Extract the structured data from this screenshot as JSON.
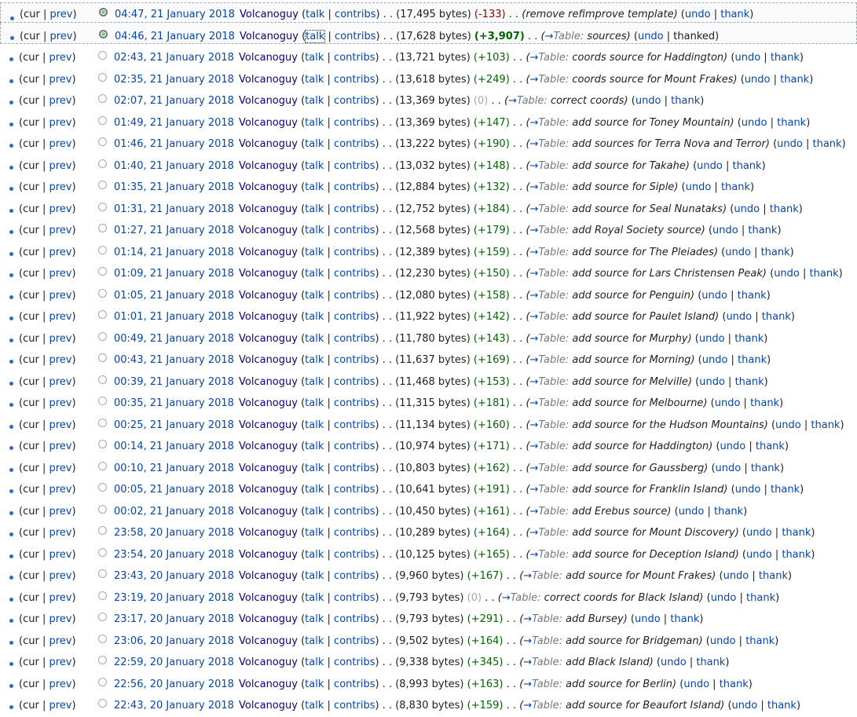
{
  "labels": {
    "cur": "cur",
    "prev": "prev",
    "talk": "talk",
    "contribs": "contribs",
    "undo": "undo",
    "thank": "thank",
    "thanked": "thanked",
    "arrow": "→",
    "section": "Table:"
  },
  "rows": [
    {
      "date": "04:47, 21 January 2018",
      "user": "Volcanoguy",
      "size": "(17,495 bytes)",
      "diff": "(-133)",
      "diffType": "neg",
      "bold": false,
      "section": false,
      "summary": "remove refimprove template",
      "thanked": false,
      "checked": true
    },
    {
      "date": "04:46, 21 January 2018",
      "user": "Volcanoguy",
      "size": "(17,628 bytes)",
      "diff": "(+3,907)",
      "diffType": "pos",
      "bold": true,
      "section": true,
      "summary": "sources",
      "thanked": true,
      "checked": true
    },
    {
      "date": "02:43, 21 January 2018",
      "user": "Volcanoguy",
      "size": "(13,721 bytes)",
      "diff": "(+103)",
      "diffType": "pos",
      "bold": false,
      "section": true,
      "summary": "coords source for Haddington",
      "thanked": false,
      "checked": false
    },
    {
      "date": "02:35, 21 January 2018",
      "user": "Volcanoguy",
      "size": "(13,618 bytes)",
      "diff": "(+249)",
      "diffType": "pos",
      "bold": false,
      "section": true,
      "summary": "coords source for Mount Frakes",
      "thanked": false,
      "checked": false
    },
    {
      "date": "02:07, 21 January 2018",
      "user": "Volcanoguy",
      "size": "(13,369 bytes)",
      "diff": "(0)",
      "diffType": "zero",
      "bold": false,
      "section": true,
      "summary": "correct coords",
      "thanked": false,
      "checked": false
    },
    {
      "date": "01:49, 21 January 2018",
      "user": "Volcanoguy",
      "size": "(13,369 bytes)",
      "diff": "(+147)",
      "diffType": "pos",
      "bold": false,
      "section": true,
      "summary": "add source for Toney Mountain",
      "thanked": false,
      "checked": false
    },
    {
      "date": "01:46, 21 January 2018",
      "user": "Volcanoguy",
      "size": "(13,222 bytes)",
      "diff": "(+190)",
      "diffType": "pos",
      "bold": false,
      "section": true,
      "summary": "add sources for Terra Nova and Terror",
      "thanked": false,
      "checked": false
    },
    {
      "date": "01:40, 21 January 2018",
      "user": "Volcanoguy",
      "size": "(13,032 bytes)",
      "diff": "(+148)",
      "diffType": "pos",
      "bold": false,
      "section": true,
      "summary": "add source for Takahe",
      "thanked": false,
      "checked": false
    },
    {
      "date": "01:35, 21 January 2018",
      "user": "Volcanoguy",
      "size": "(12,884 bytes)",
      "diff": "(+132)",
      "diffType": "pos",
      "bold": false,
      "section": true,
      "summary": "add source for Siple",
      "thanked": false,
      "checked": false
    },
    {
      "date": "01:31, 21 January 2018",
      "user": "Volcanoguy",
      "size": "(12,752 bytes)",
      "diff": "(+184)",
      "diffType": "pos",
      "bold": false,
      "section": true,
      "summary": "add source for Seal Nunataks",
      "thanked": false,
      "checked": false
    },
    {
      "date": "01:27, 21 January 2018",
      "user": "Volcanoguy",
      "size": "(12,568 bytes)",
      "diff": "(+179)",
      "diffType": "pos",
      "bold": false,
      "section": true,
      "summary": "add Royal Society source",
      "thanked": false,
      "checked": false
    },
    {
      "date": "01:14, 21 January 2018",
      "user": "Volcanoguy",
      "size": "(12,389 bytes)",
      "diff": "(+159)",
      "diffType": "pos",
      "bold": false,
      "section": true,
      "summary": "add source for The Pleiades",
      "thanked": false,
      "checked": false
    },
    {
      "date": "01:09, 21 January 2018",
      "user": "Volcanoguy",
      "size": "(12,230 bytes)",
      "diff": "(+150)",
      "diffType": "pos",
      "bold": false,
      "section": true,
      "summary": "add source for Lars Christensen Peak",
      "thanked": false,
      "checked": false
    },
    {
      "date": "01:05, 21 January 2018",
      "user": "Volcanoguy",
      "size": "(12,080 bytes)",
      "diff": "(+158)",
      "diffType": "pos",
      "bold": false,
      "section": true,
      "summary": "add source for Penguin",
      "thanked": false,
      "checked": false
    },
    {
      "date": "01:01, 21 January 2018",
      "user": "Volcanoguy",
      "size": "(11,922 bytes)",
      "diff": "(+142)",
      "diffType": "pos",
      "bold": false,
      "section": true,
      "summary": "add source for Paulet Island",
      "thanked": false,
      "checked": false
    },
    {
      "date": "00:49, 21 January 2018",
      "user": "Volcanoguy",
      "size": "(11,780 bytes)",
      "diff": "(+143)",
      "diffType": "pos",
      "bold": false,
      "section": true,
      "summary": "add source for Murphy",
      "thanked": false,
      "checked": false
    },
    {
      "date": "00:43, 21 January 2018",
      "user": "Volcanoguy",
      "size": "(11,637 bytes)",
      "diff": "(+169)",
      "diffType": "pos",
      "bold": false,
      "section": true,
      "summary": "add source for Morning",
      "thanked": false,
      "checked": false
    },
    {
      "date": "00:39, 21 January 2018",
      "user": "Volcanoguy",
      "size": "(11,468 bytes)",
      "diff": "(+153)",
      "diffType": "pos",
      "bold": false,
      "section": true,
      "summary": "add source for Melville",
      "thanked": false,
      "checked": false
    },
    {
      "date": "00:35, 21 January 2018",
      "user": "Volcanoguy",
      "size": "(11,315 bytes)",
      "diff": "(+181)",
      "diffType": "pos",
      "bold": false,
      "section": true,
      "summary": "add source for Melbourne",
      "thanked": false,
      "checked": false
    },
    {
      "date": "00:25, 21 January 2018",
      "user": "Volcanoguy",
      "size": "(11,134 bytes)",
      "diff": "(+160)",
      "diffType": "pos",
      "bold": false,
      "section": true,
      "summary": "add source for the Hudson Mountains",
      "thanked": false,
      "checked": false
    },
    {
      "date": "00:14, 21 January 2018",
      "user": "Volcanoguy",
      "size": "(10,974 bytes)",
      "diff": "(+171)",
      "diffType": "pos",
      "bold": false,
      "section": true,
      "summary": "add source for Haddington",
      "thanked": false,
      "checked": false
    },
    {
      "date": "00:10, 21 January 2018",
      "user": "Volcanoguy",
      "size": "(10,803 bytes)",
      "diff": "(+162)",
      "diffType": "pos",
      "bold": false,
      "section": true,
      "summary": "add source for Gaussberg",
      "thanked": false,
      "checked": false
    },
    {
      "date": "00:05, 21 January 2018",
      "user": "Volcanoguy",
      "size": "(10,641 bytes)",
      "diff": "(+191)",
      "diffType": "pos",
      "bold": false,
      "section": true,
      "summary": "add source for Franklin Island",
      "thanked": false,
      "checked": false
    },
    {
      "date": "00:02, 21 January 2018",
      "user": "Volcanoguy",
      "size": "(10,450 bytes)",
      "diff": "(+161)",
      "diffType": "pos",
      "bold": false,
      "section": true,
      "summary": "add Erebus source",
      "thanked": false,
      "checked": false
    },
    {
      "date": "23:58, 20 January 2018",
      "user": "Volcanoguy",
      "size": "(10,289 bytes)",
      "diff": "(+164)",
      "diffType": "pos",
      "bold": false,
      "section": true,
      "summary": "add source for Mount Discovery",
      "thanked": false,
      "checked": false
    },
    {
      "date": "23:54, 20 January 2018",
      "user": "Volcanoguy",
      "size": "(10,125 bytes)",
      "diff": "(+165)",
      "diffType": "pos",
      "bold": false,
      "section": true,
      "summary": "add source for Deception Island",
      "thanked": false,
      "checked": false
    },
    {
      "date": "23:43, 20 January 2018",
      "user": "Volcanoguy",
      "size": "(9,960 bytes)",
      "diff": "(+167)",
      "diffType": "pos",
      "bold": false,
      "section": true,
      "summary": "add source for Mount Frakes",
      "thanked": false,
      "checked": false
    },
    {
      "date": "23:19, 20 January 2018",
      "user": "Volcanoguy",
      "size": "(9,793 bytes)",
      "diff": "(0)",
      "diffType": "zero",
      "bold": false,
      "section": true,
      "summary": "correct coords for Black Island",
      "thanked": false,
      "checked": false
    },
    {
      "date": "23:17, 20 January 2018",
      "user": "Volcanoguy",
      "size": "(9,793 bytes)",
      "diff": "(+291)",
      "diffType": "pos",
      "bold": false,
      "section": true,
      "summary": "add Bursey",
      "thanked": false,
      "checked": false
    },
    {
      "date": "23:06, 20 January 2018",
      "user": "Volcanoguy",
      "size": "(9,502 bytes)",
      "diff": "(+164)",
      "diffType": "pos",
      "bold": false,
      "section": true,
      "summary": "add source for Bridgeman",
      "thanked": false,
      "checked": false
    },
    {
      "date": "22:59, 20 January 2018",
      "user": "Volcanoguy",
      "size": "(9,338 bytes)",
      "diff": "(+345)",
      "diffType": "pos",
      "bold": false,
      "section": true,
      "summary": "add Black Island",
      "thanked": false,
      "checked": false
    },
    {
      "date": "22:56, 20 January 2018",
      "user": "Volcanoguy",
      "size": "(8,993 bytes)",
      "diff": "(+163)",
      "diffType": "pos",
      "bold": false,
      "section": true,
      "summary": "add source for Berlin",
      "thanked": false,
      "checked": false
    },
    {
      "date": "22:43, 20 January 2018",
      "user": "Volcanoguy",
      "size": "(8,830 bytes)",
      "diff": "(+159)",
      "diffType": "pos",
      "bold": false,
      "section": true,
      "summary": "add source for Beaufort Island",
      "thanked": false,
      "checked": false
    }
  ],
  "colors": {
    "link": "#0645ad",
    "user": "#0b0080",
    "positive": "#006400",
    "negative": "#8b0000",
    "zero": "#a2a9b1",
    "bullet": "#3366cc"
  }
}
